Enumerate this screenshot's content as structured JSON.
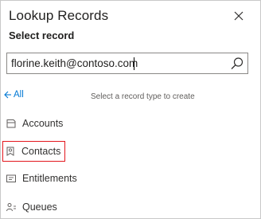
{
  "dialog": {
    "title": "Lookup Records",
    "subtitle": "Select record",
    "close_icon": "close-icon"
  },
  "search": {
    "value": "florine.keith@contoso.com",
    "icon": "search-icon"
  },
  "nav": {
    "back_label": "All",
    "back_icon": "arrow-left-icon",
    "hint": "Select a record type to create"
  },
  "record_types": [
    {
      "label": "Accounts",
      "icon": "account-icon",
      "highlighted": false
    },
    {
      "label": "Contacts",
      "icon": "contact-icon",
      "highlighted": true
    },
    {
      "label": "Entitlements",
      "icon": "entitlement-icon",
      "highlighted": false
    },
    {
      "label": "Queues",
      "icon": "queue-icon",
      "highlighted": false
    }
  ],
  "colors": {
    "link": "#0078d4",
    "highlight_border": "#e3171d"
  }
}
